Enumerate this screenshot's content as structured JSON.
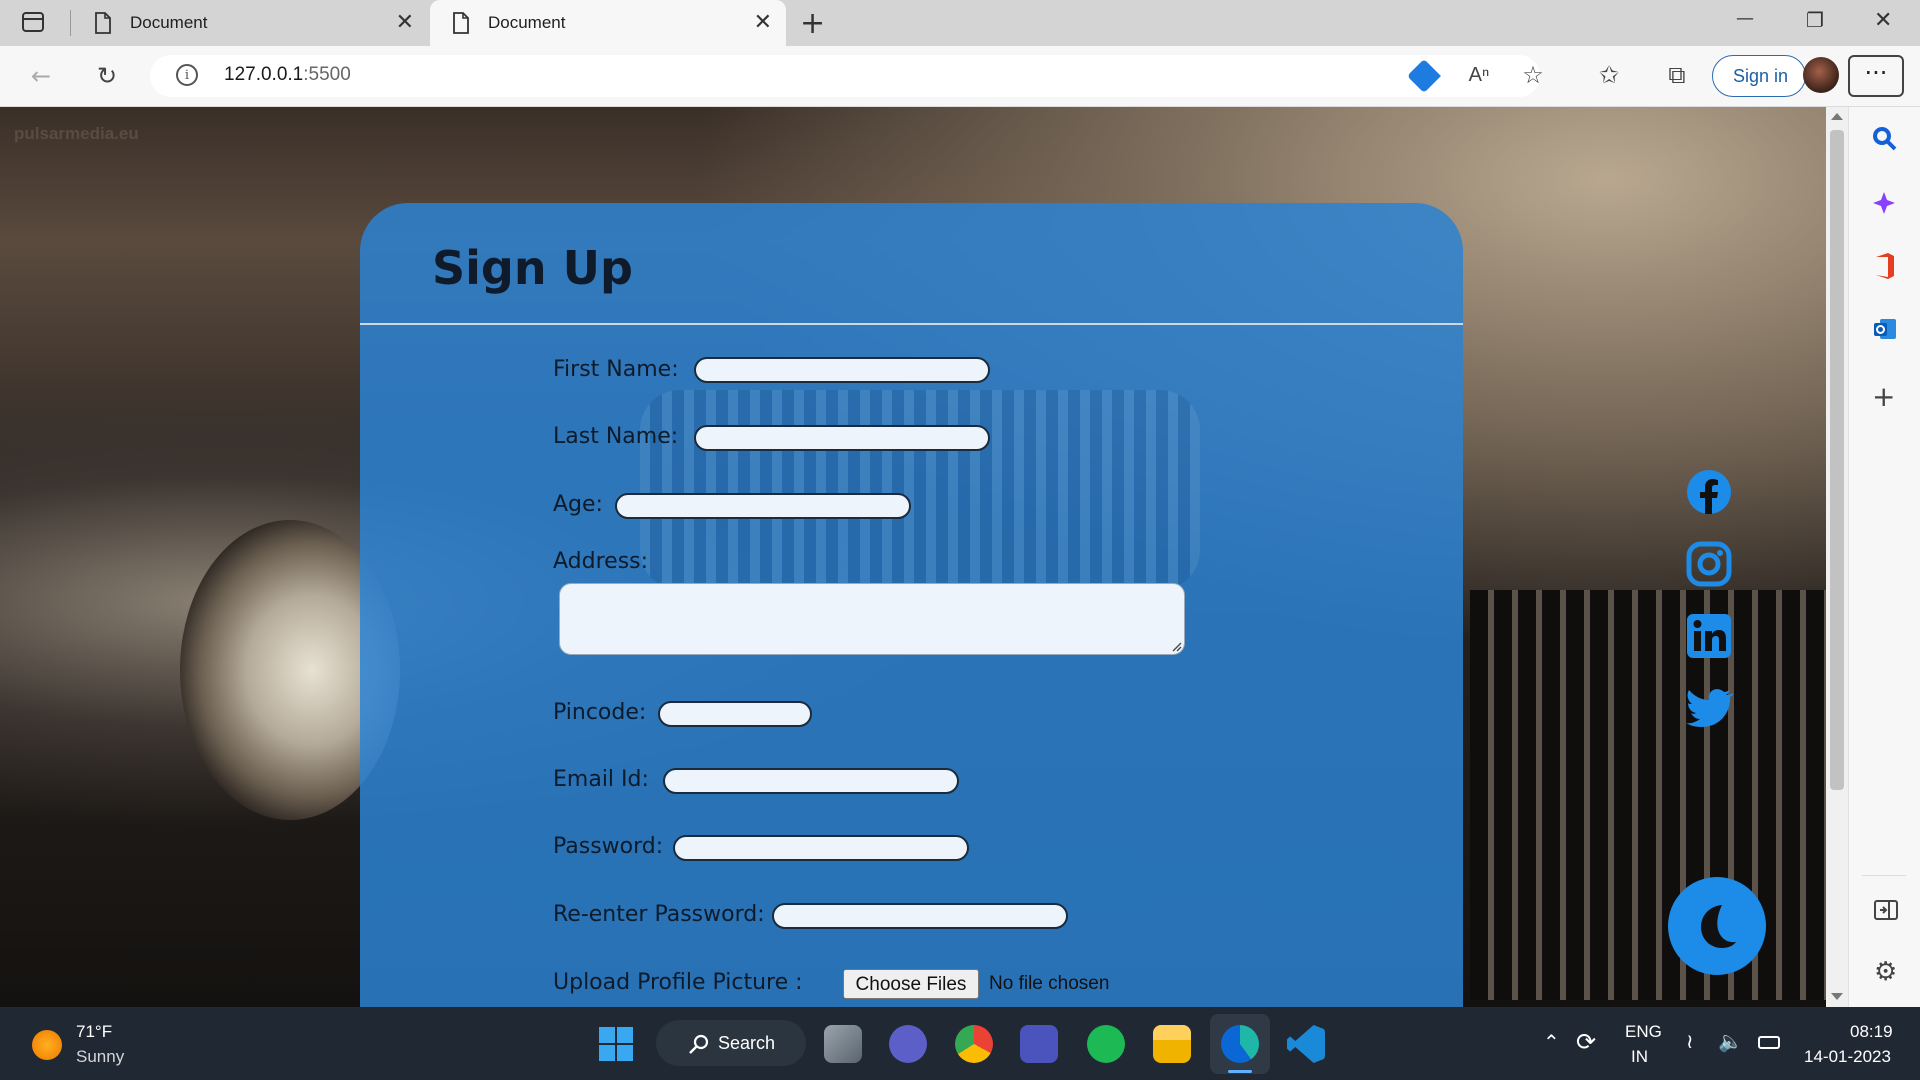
{
  "browser": {
    "tabs": [
      {
        "title": "Document",
        "close": "✕"
      },
      {
        "title": "Document",
        "close": "✕"
      }
    ],
    "new_tab": "+",
    "address": {
      "host": "127.0.0.1",
      "port": ":5500"
    },
    "signin_label": "Sign in",
    "more_label": "···",
    "window_controls": {
      "minimize": "—",
      "restore": "❐",
      "close": "✕"
    }
  },
  "page": {
    "watermark": "pulsarmedia.eu",
    "form": {
      "title": "Sign Up",
      "fields": {
        "first_name": "First Name:",
        "last_name": "Last Name:",
        "age": "Age:",
        "address": "Address:",
        "pincode": "Pincode:",
        "email": "Email Id:",
        "password": "Password:",
        "reenter_password": "Re-enter Password:",
        "upload": "Upload Profile Picture :"
      },
      "file_button": "Choose Files",
      "file_status": "No file chosen"
    },
    "social_icons": [
      "facebook-icon",
      "instagram-icon",
      "linkedin-icon",
      "twitter-icon"
    ],
    "theme_toggle_icon": "moon-icon"
  },
  "taskbar": {
    "weather": {
      "temp": "71°F",
      "condition": "Sunny"
    },
    "search_label": "Search",
    "language": {
      "line1": "ENG",
      "line2": "IN"
    },
    "time": "08:19",
    "date": "14-01-2023"
  },
  "colors": {
    "card": "#2c82d2",
    "moon_button": "#1d8ce8",
    "taskbar": "#1f2833"
  }
}
